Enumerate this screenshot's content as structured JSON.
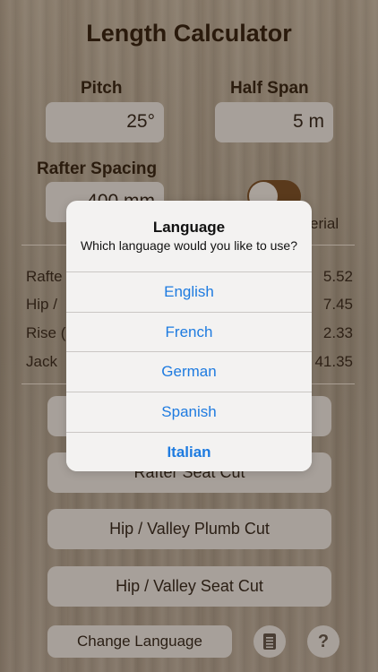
{
  "app": {
    "title": "Length Calculator"
  },
  "inputs": {
    "pitch_label": "Pitch",
    "pitch_value": "25°",
    "half_span_label": "Half Span",
    "half_span_value": "5 m",
    "rafter_spacing_label": "Rafter Spacing",
    "rafter_spacing_value": "400 mm",
    "units_label": "erial"
  },
  "results": [
    {
      "label": "Rafte",
      "value": "5.52"
    },
    {
      "label": "Hip /",
      "value": "7.45"
    },
    {
      "label": "Rise (",
      "value": "2.33"
    },
    {
      "label": "Jack",
      "value": "41.35"
    }
  ],
  "buttons": {
    "rafter_plumb_cut": "",
    "rafter_seat_cut": "Rafter Seat Cut",
    "hip_plumb_cut": "Hip / Valley Plumb Cut",
    "hip_seat_cut": "Hip / Valley Seat Cut",
    "change_language": "Change Language",
    "help": "?"
  },
  "icons": {
    "notes": "notepad-icon",
    "help": "question-icon"
  },
  "dialog": {
    "title": "Language",
    "message": "Which language would you like to use?",
    "options": [
      "English",
      "French",
      "German",
      "Spanish",
      "Italian"
    ],
    "preferred": "Italian"
  },
  "colors": {
    "accent": "#1e7be0",
    "title": "#2a1a0c",
    "control": "#a7a09a"
  }
}
